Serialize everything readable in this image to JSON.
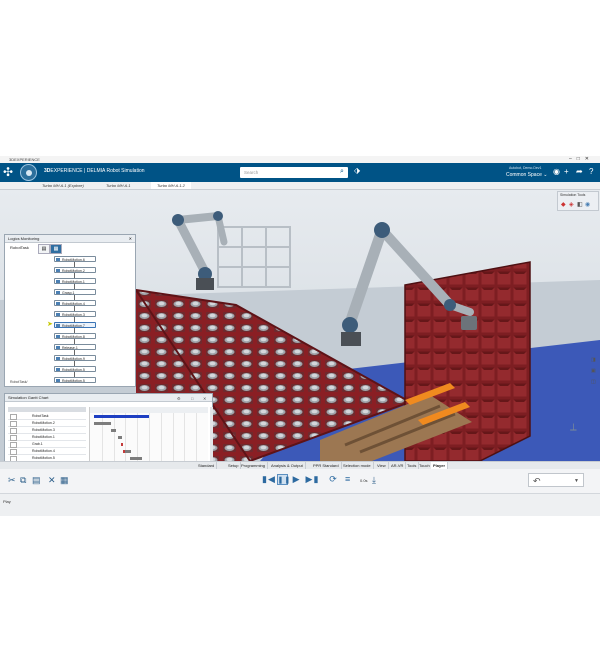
{
  "window": {
    "title": "3DEXPERIENCE",
    "controls": [
      "–",
      "□",
      "✕"
    ]
  },
  "topbar": {
    "brand_3d": "3D",
    "brand_rest": "EXPERIENCE | DELMIA",
    "app_name": "Robot Simulation",
    "search_placeholder": "Search",
    "user_name": "Autobot, Demo.Dev1",
    "space": "Common Space ⌄",
    "colors": {
      "bar": "#005386",
      "accent": "#2b6f9c"
    }
  },
  "tabs": [
    {
      "label": "Turbo MH A.1 (Explore)"
    },
    {
      "label": "Turbo MH A.1"
    },
    {
      "label": "Turbo MH A.1.2",
      "active": true
    }
  ],
  "logics_panel": {
    "title": "Logics Monitoring",
    "root_label": "RobotTask",
    "footer": "RobotTask/",
    "nodes": [
      "RobotMotion.6",
      "RobotMotion.2",
      "RobotMotion.1",
      "Grasp.1",
      "RobotMotion.4",
      "RobotMotion.3",
      "RobotMotion.7",
      "RobotMotion.8",
      "Release.1",
      "RobotMotion.9",
      "RobotMotion.5",
      "RobotMotion.5"
    ],
    "current_node_index": 6
  },
  "gantt": {
    "title": "Simulation Gantt Chart",
    "rows": [
      "RobotTask",
      "RobotMotion.2",
      "RobotMotion.3",
      "RobotMotion.1",
      "Grab.1",
      "RobotMotion.4",
      "RobotMotion.5",
      "RobotMotion.7",
      "RobotMotion.8"
    ],
    "bars": [
      {
        "row": 0,
        "start": 0.03,
        "end": 0.5,
        "color": "#1e3fc2"
      },
      {
        "row": 1,
        "start": 0.03,
        "end": 0.18,
        "color": "#7d7d7d"
      },
      {
        "row": 2,
        "start": 0.18,
        "end": 0.22,
        "color": "#7d7d7d"
      },
      {
        "row": 3,
        "start": 0.24,
        "end": 0.27,
        "color": "#7d7d7d"
      },
      {
        "row": 5,
        "start": 0.28,
        "end": 0.35,
        "color": "#7d7d7d"
      },
      {
        "row": 6,
        "start": 0.34,
        "end": 0.44,
        "color": "#7d7d7d"
      },
      {
        "row": 7,
        "start": 0.44,
        "end": 0.47,
        "color": "#7d7d7d"
      }
    ],
    "markers": [
      {
        "row": 4,
        "at": 0.26
      },
      {
        "row": 5,
        "at": 0.28
      }
    ]
  },
  "sim_tools": {
    "title": "Simulation Tools"
  },
  "section_tabs": [
    "Standard",
    "Setup",
    "Programming",
    "Analysis & Output",
    "PPR Standard",
    "Selection mode",
    "View",
    "AR-VR",
    "Tools",
    "Touch",
    "Player"
  ],
  "active_section": "Player",
  "player": {
    "speed": "0.0s"
  },
  "status": {
    "text": "Play"
  }
}
